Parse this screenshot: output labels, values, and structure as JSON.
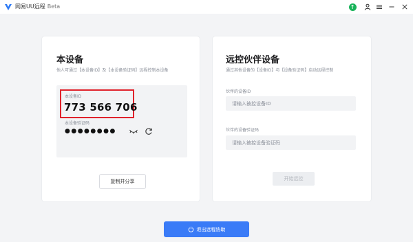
{
  "app": {
    "title": "网易UU远程",
    "badge": "Beta"
  },
  "icons": {
    "logo": "uu-logo-icon",
    "upgrade": "upgrade-icon",
    "user": "user-icon",
    "menu": "menu-icon",
    "minimize": "minimize-icon",
    "close": "close-icon",
    "eye": "eye-hidden-icon",
    "refresh": "refresh-icon",
    "power": "power-icon"
  },
  "colors": {
    "accent": "#3a7bf7",
    "highlight": "#e0222b",
    "upgrade": "#19b35a"
  },
  "this_device": {
    "title": "本设备",
    "subtitle": "他人可通过【本设备ID】及【本设备验证码】远程控制本设备",
    "id_label": "本设备ID",
    "id_value": "773 566 706",
    "code_label": "本设备验证码",
    "code_masked": "●●●●●●●●",
    "copy_button": "复制并分享"
  },
  "remote_device": {
    "title": "远控伙伴设备",
    "subtitle": "通过其他设备的【设备ID】与【设备验证码】启动远程控制",
    "id_label": "伙伴的设备ID",
    "id_placeholder": "请输入被控设备ID",
    "code_label": "伙伴的设备验证码",
    "code_placeholder": "请输入被控设备验证码",
    "start_button": "开始远控"
  },
  "exit_button": "退出远程协助"
}
